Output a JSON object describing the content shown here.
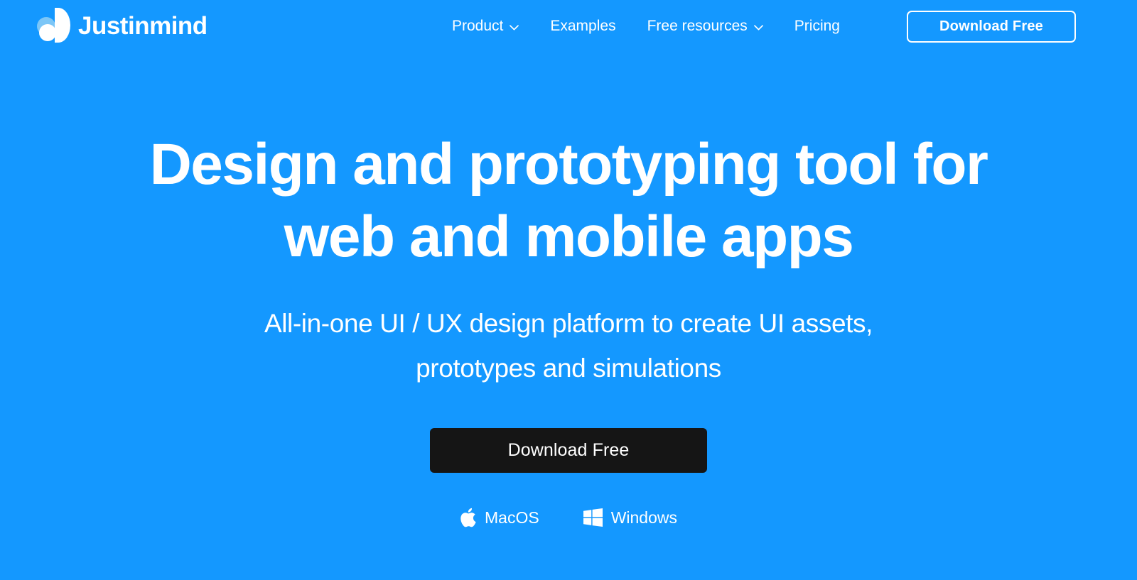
{
  "theme": {
    "background": "#1498ff",
    "text_on_blue": "#ffffff",
    "cta_dark": "#151515",
    "logo_light_blue": "#7cc6f7"
  },
  "header": {
    "logo": {
      "name": "Justinmind",
      "mark_icon": "justinmind-logo-icon"
    },
    "nav": [
      {
        "label": "Product",
        "has_dropdown": true,
        "icon": "chevron-down-icon"
      },
      {
        "label": "Examples",
        "has_dropdown": false,
        "icon": ""
      },
      {
        "label": "Free resources",
        "has_dropdown": true,
        "icon": "chevron-down-icon"
      },
      {
        "label": "Pricing",
        "has_dropdown": false,
        "icon": ""
      }
    ],
    "cta": {
      "label": "Download Free"
    }
  },
  "hero": {
    "headline": "Design and prototyping tool for web and mobile apps",
    "subheadline": "All-in-one UI / UX design platform to create UI assets, prototypes and simulations",
    "cta": {
      "label": "Download Free"
    },
    "platforms": [
      {
        "label": "MacOS",
        "icon": "apple-icon"
      },
      {
        "label": "Windows",
        "icon": "windows-icon"
      }
    ]
  }
}
